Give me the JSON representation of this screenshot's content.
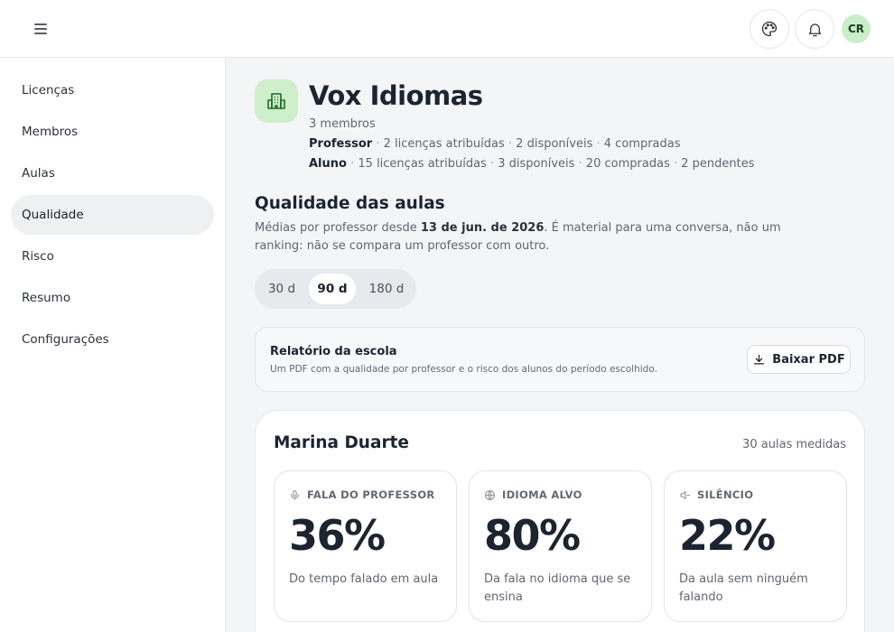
{
  "header": {
    "avatar_initials": "CR",
    "icons": [
      "menu-icon",
      "palette-icon",
      "bell-icon"
    ]
  },
  "sidebar": {
    "items": [
      {
        "label": "Licenças"
      },
      {
        "label": "Membros"
      },
      {
        "label": "Aulas"
      },
      {
        "label": "Qualidade",
        "active": true
      },
      {
        "label": "Risco"
      },
      {
        "label": "Resumo"
      },
      {
        "label": "Configurações"
      }
    ]
  },
  "org": {
    "name": "Vox Idiomas",
    "members": "3 membros",
    "icon": "building-icon",
    "professor": {
      "role": "Professor",
      "assigned": "2 licenças atribuídas",
      "available": "2 disponíveis",
      "purchased": "4 compradas"
    },
    "aluno": {
      "role": "Aluno",
      "assigned": "15 licenças atribuídas",
      "available": "3 disponíveis",
      "purchased": "20 compradas",
      "pending": "2 pendentes"
    },
    "separator": "·"
  },
  "quality": {
    "title": "Qualidade das aulas",
    "desc_before": "Médias por professor desde ",
    "desc_date": "13 de jun. de 2026",
    "desc_after": ". É material para uma conversa, não um ranking: não se compara um professor com outro.",
    "periods": [
      {
        "label": "30 d"
      },
      {
        "label": "90 d",
        "selected": true
      },
      {
        "label": "180 d"
      }
    ]
  },
  "report": {
    "title": "Relatório da escola",
    "subtitle": "Um PDF com a qualidade por professor e o risco dos alunos do período escolhido.",
    "button_label": "Baixar PDF",
    "button_icon": "download-icon"
  },
  "teacher": {
    "name": "Marina Duarte",
    "lessons": "30 aulas medidas",
    "metrics": [
      {
        "icon": "microphone-icon",
        "label": "FALA DO PROFESSOR",
        "value": "36%",
        "desc": "Do tempo falado em aula"
      },
      {
        "icon": "globe-icon",
        "label": "IDIOMA ALVO",
        "value": "80%",
        "desc": "Da fala no idioma que se ensina"
      },
      {
        "icon": "speaker-muted-icon",
        "label": "SILÊNCIO",
        "value": "22%",
        "desc": "Da aula sem ninguém falando"
      }
    ]
  },
  "colors": {
    "accent_green": "#cfeecb",
    "background": "#f4f5f6",
    "text_primary": "#1c2430"
  }
}
